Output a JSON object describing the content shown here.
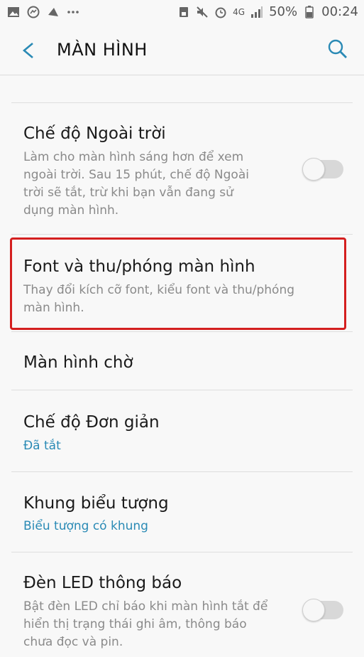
{
  "status": {
    "network": "4G",
    "battery": "50%",
    "time": "00:24",
    "icons": [
      "gallery-icon",
      "messenger-icon",
      "bird-icon",
      "more-icon",
      "save-icon",
      "mute-icon",
      "alarm-icon",
      "signal-icon",
      "battery-icon"
    ]
  },
  "header": {
    "title": "MÀN HÌNH"
  },
  "items": [
    {
      "title": "Chế độ Ngoài trời",
      "description": [
        "Làm cho màn hình sáng hơn để xem",
        "ngoài trời. Sau 15 phút, chế độ Ngoài",
        "trời sẽ tắt, trừ khi bạn vẫn đang sử",
        "dụng màn hình."
      ],
      "toggle_on": false
    },
    {
      "title": "Font và thu/phóng màn hình",
      "description": [
        "Thay đổi kích cỡ font, kiểu font và thu/phóng",
        "màn hình."
      ],
      "highlighted": true
    },
    {
      "title": "Màn hình chờ"
    },
    {
      "title": "Chế độ Đơn giản",
      "summary": "Đã tắt"
    },
    {
      "title": "Khung biểu tượng",
      "summary": "Biểu tượng có khung"
    },
    {
      "title": "Đèn LED thông báo",
      "description": [
        "Bật đèn LED chỉ báo khi màn hình tắt để",
        "hiển thị trạng thái ghi âm, thông báo",
        "chưa đọc và pin."
      ],
      "toggle_on": false
    }
  ],
  "colors": {
    "accent": "#2a8ab5",
    "highlight": "#d41f1f",
    "background": "#f8f8f8"
  }
}
